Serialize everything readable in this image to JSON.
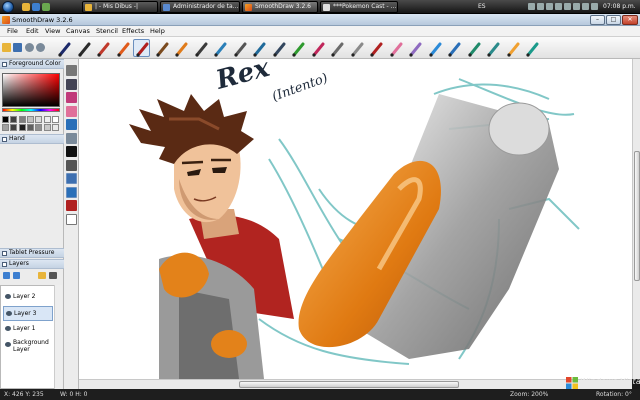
{
  "taskbar": {
    "tasks": [
      {
        "label": "| - Mis Dibus -|",
        "active": false
      },
      {
        "label": "Administrador de ta...",
        "active": false
      },
      {
        "label": "SmoothDraw 3.2.6",
        "active": true
      },
      {
        "label": "***Pokemon Cast - ...",
        "active": false
      }
    ],
    "language": "ES",
    "clock": "07:08 p.m."
  },
  "window": {
    "title": "SmoothDraw 3.2.6",
    "minimize_label": "–",
    "maximize_label": "□",
    "close_label": "✕"
  },
  "menu": [
    "File",
    "Edit",
    "View",
    "Canvas",
    "Stencil",
    "Effects",
    "Help"
  ],
  "toolbar": {
    "file_tools": [
      "open-icon",
      "save-icon",
      "undo-icon",
      "redo-icon"
    ],
    "brushes": [
      {
        "name": "pen-icon",
        "color": "#1d2a6b"
      },
      {
        "name": "pencil-icon",
        "color": "#2b2b2b"
      },
      {
        "name": "marker-icon",
        "color": "#c0392b"
      },
      {
        "name": "crayon-icon",
        "color": "#e05a1a"
      },
      {
        "name": "chalk-icon",
        "color": "#b01e1e"
      },
      {
        "name": "brush-icon",
        "color": "#7a4a1e"
      },
      {
        "name": "art-pen-icon",
        "color": "#e07b1a"
      },
      {
        "name": "airbrush-icon",
        "color": "#3a3a3a"
      },
      {
        "name": "watercolor-icon",
        "color": "#2a7fb8"
      },
      {
        "name": "flat-brush-icon",
        "color": "#555555"
      },
      {
        "name": "blender-icon",
        "color": "#1f6a9a"
      },
      {
        "name": "wet-brush-icon",
        "color": "#33465e"
      },
      {
        "name": "grass-icon",
        "color": "#2e9a2e"
      },
      {
        "name": "flower-icon",
        "color": "#c0265a"
      },
      {
        "name": "sponge-icon",
        "color": "#6b6b6b"
      },
      {
        "name": "smudge-icon",
        "color": "#8a8a8a"
      },
      {
        "name": "stamp-icon",
        "color": "#b02020"
      },
      {
        "name": "eraser-icon",
        "color": "#e06f9a"
      },
      {
        "name": "soft-eraser-icon",
        "color": "#8e6ac0"
      },
      {
        "name": "water-drop-icon",
        "color": "#2b8ad8"
      },
      {
        "name": "bucket-icon",
        "color": "#2a6fb8"
      },
      {
        "name": "tube-icon",
        "color": "#1f8a6a"
      },
      {
        "name": "palette-knife-icon",
        "color": "#2a8a8a"
      },
      {
        "name": "leaf-icon",
        "color": "#f0a030"
      },
      {
        "name": "glitter-icon",
        "color": "#1a9a8a"
      }
    ],
    "selected_brush_index": 4
  },
  "left_panel": {
    "foreground_color_label": "Foreground Color",
    "foreground_color": "#cc2a1a",
    "swatches": [
      "#000000",
      "#3f3f3f",
      "#7f7f7f",
      "#bfbfbf",
      "#dcdcdc",
      "#eeeeee",
      "#ffffff",
      "#a0a0a0",
      "#404040",
      "#202020",
      "#606060",
      "#909090",
      "#c8c8c8",
      "#e8e8e8"
    ],
    "tool_section_label": "Hand",
    "tablet_label": "Tablet Pressure",
    "layers_label": "Layers",
    "layers": [
      {
        "label": "Layer 2",
        "selected": false
      },
      {
        "label": "Layer 3",
        "selected": true
      },
      {
        "label": "Layer 1",
        "selected": false
      },
      {
        "label": "Background Layer",
        "selected": false
      }
    ]
  },
  "tool_column": [
    "select-icon",
    "move-icon",
    "eyedropper-icon",
    "eraser-icon",
    "bucket-icon",
    "smudge-icon",
    "text-icon",
    "color-picker-icon",
    "hand-icon",
    "rectangle-select-icon",
    "stamp-icon",
    "color-swatch-icon"
  ],
  "canvas": {
    "drawing": {
      "signature_text": "Rex",
      "subtitle_text": "(Intento)"
    }
  },
  "status": {
    "coords": "X: 426 Y: 235",
    "size": "W: 0 H: 0",
    "zoom": "Zoom: 200%",
    "rotation": "Rotation: 0°"
  },
  "watermark": "Windows Vista"
}
